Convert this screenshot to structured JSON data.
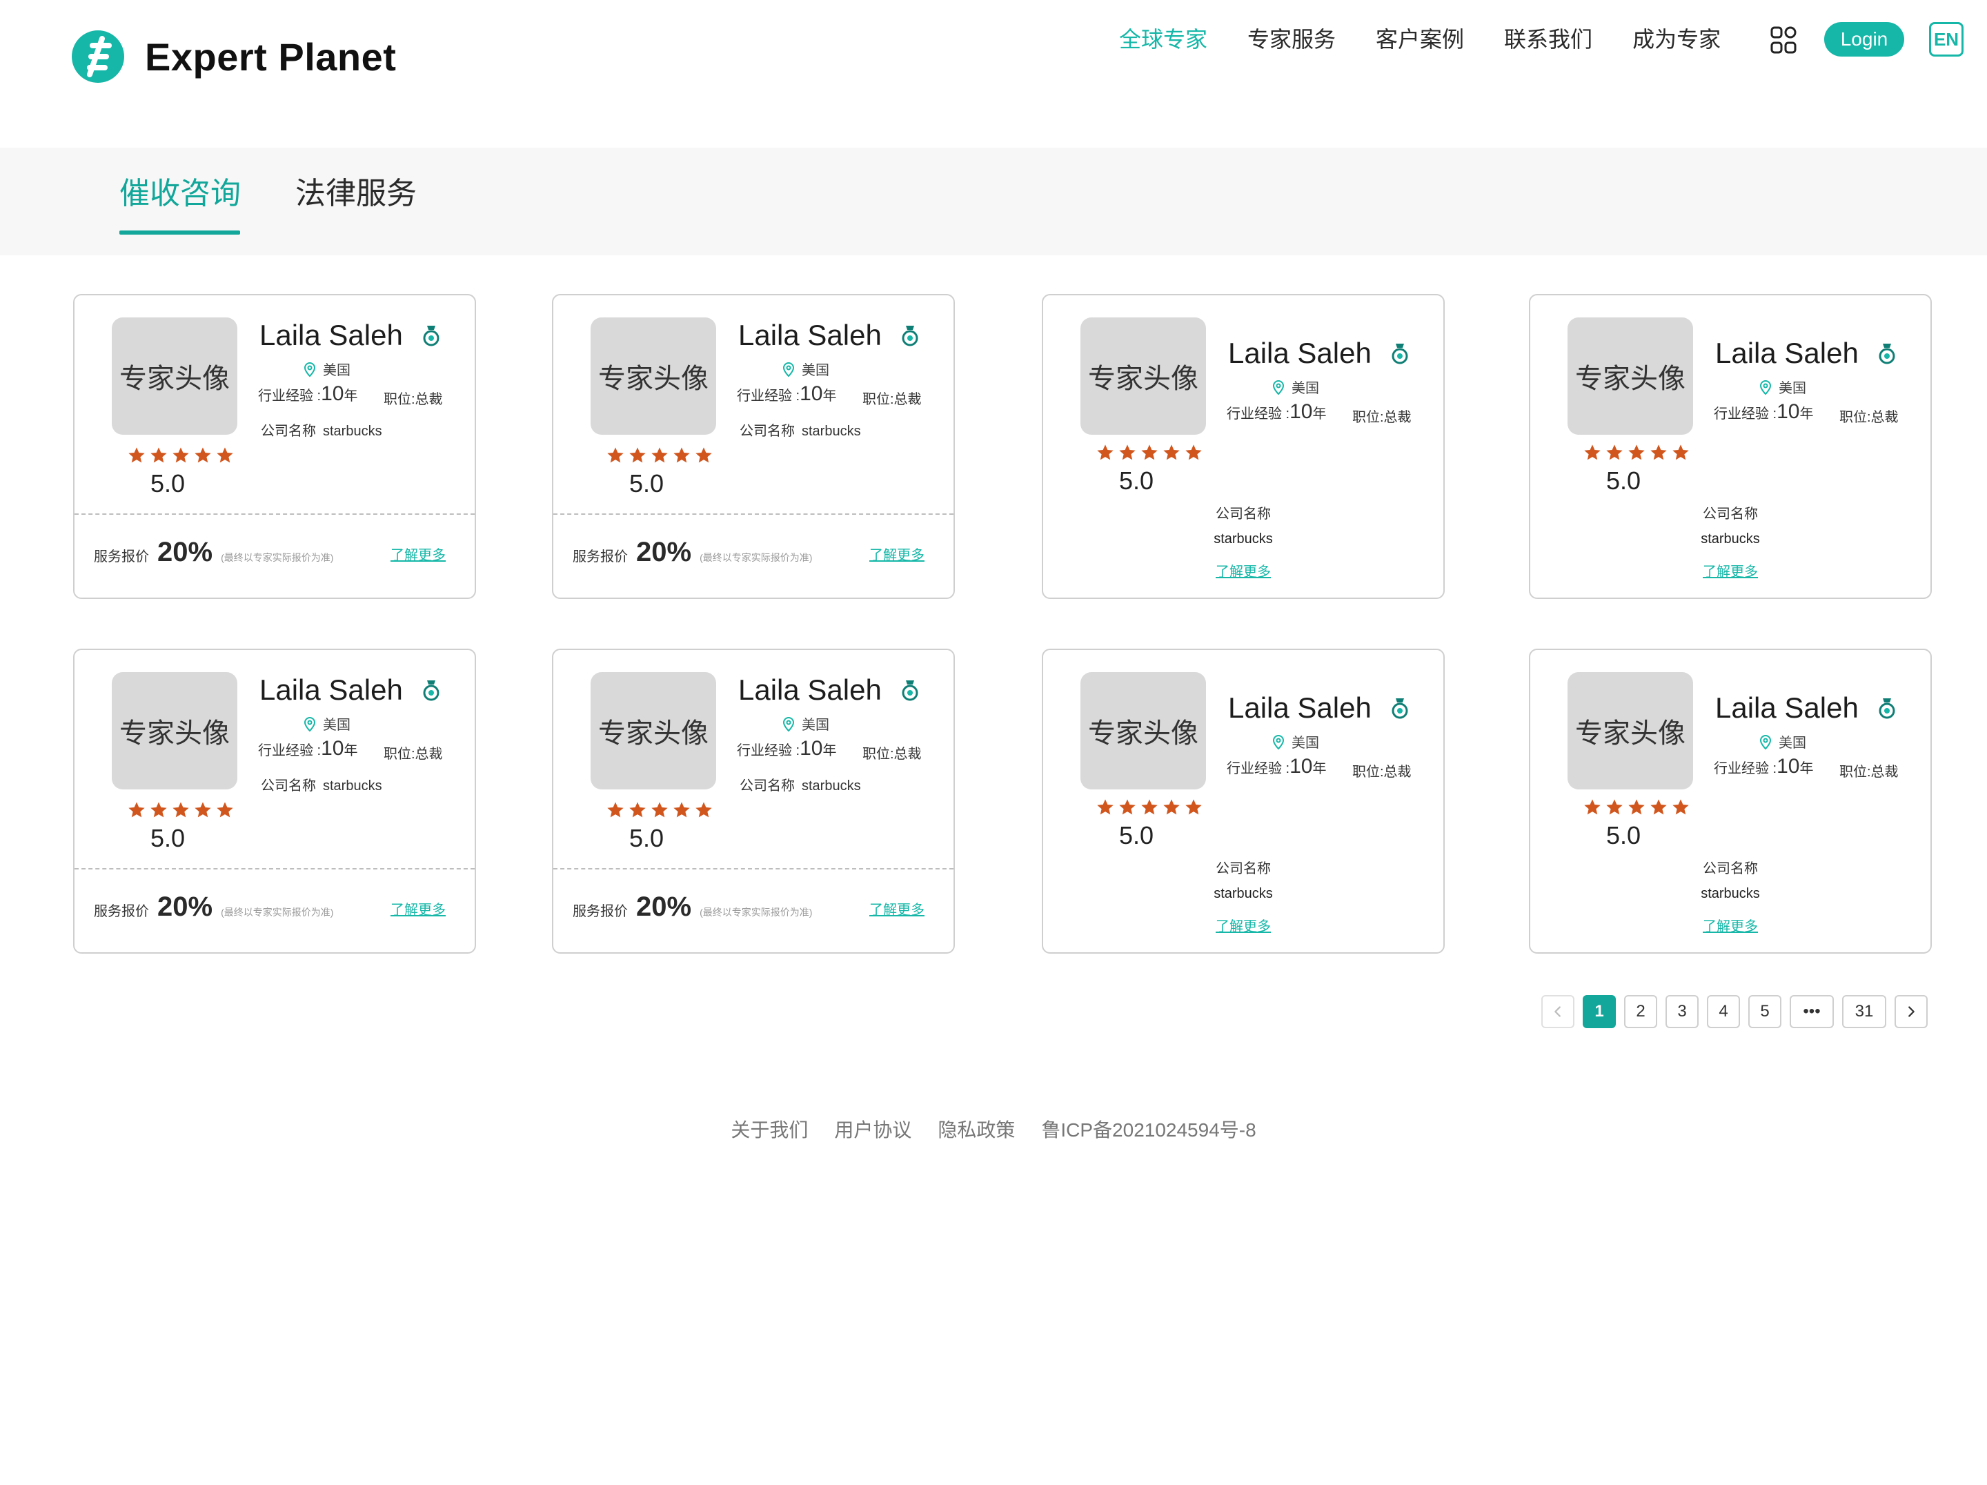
{
  "brand": {
    "name": "Expert Planet"
  },
  "nav": {
    "items": [
      "全球专家",
      "专家服务",
      "客户案例",
      "联系我们",
      "成为专家"
    ],
    "active_index": 0,
    "login": "Login",
    "lang": "EN"
  },
  "tabs": {
    "items": [
      "催收咨询",
      "法律服务"
    ],
    "active_index": 0
  },
  "cards": [
    {
      "avatar": "专家头像",
      "name": "Laila Saleh",
      "rating": "5.0",
      "location": "美国",
      "exp_label": "行业经验 :",
      "exp_num": "10",
      "exp_unit": "年",
      "position": "职位:总裁",
      "company_label": "公司名称",
      "company": "starbucks",
      "price_label": "服务报价",
      "price": "20%",
      "price_note": "(最终以专家实际报价为准)",
      "more": "了解更多"
    },
    {
      "avatar": "专家头像",
      "name": "Laila Saleh",
      "rating": "5.0",
      "location": "美国",
      "exp_label": "行业经验 :",
      "exp_num": "10",
      "exp_unit": "年",
      "position": "职位:总裁",
      "company_label": "公司名称",
      "company": "starbucks",
      "price_label": "服务报价",
      "price": "20%",
      "price_note": "(最终以专家实际报价为准)",
      "more": "了解更多"
    },
    {
      "avatar": "专家头像",
      "name": "Laila Saleh",
      "rating": "5.0",
      "location": "美国",
      "exp_label": "行业经验 :",
      "exp_num": "10",
      "exp_unit": "年",
      "position": "职位:总裁",
      "company_label": "公司名称",
      "company": "starbucks",
      "more": "了解更多"
    },
    {
      "avatar": "专家头像",
      "name": "Laila Saleh",
      "rating": "5.0",
      "location": "美国",
      "exp_label": "行业经验 :",
      "exp_num": "10",
      "exp_unit": "年",
      "position": "职位:总裁",
      "company_label": "公司名称",
      "company": "starbucks",
      "more": "了解更多"
    },
    {
      "avatar": "专家头像",
      "name": "Laila Saleh",
      "rating": "5.0",
      "location": "美国",
      "exp_label": "行业经验 :",
      "exp_num": "10",
      "exp_unit": "年",
      "position": "职位:总裁",
      "company_label": "公司名称",
      "company": "starbucks",
      "price_label": "服务报价",
      "price": "20%",
      "price_note": "(最终以专家实际报价为准)",
      "more": "了解更多"
    },
    {
      "avatar": "专家头像",
      "name": "Laila Saleh",
      "rating": "5.0",
      "location": "美国",
      "exp_label": "行业经验 :",
      "exp_num": "10",
      "exp_unit": "年",
      "position": "职位:总裁",
      "company_label": "公司名称",
      "company": "starbucks",
      "price_label": "服务报价",
      "price": "20%",
      "price_note": "(最终以专家实际报价为准)",
      "more": "了解更多"
    },
    {
      "avatar": "专家头像",
      "name": "Laila Saleh",
      "rating": "5.0",
      "location": "美国",
      "exp_label": "行业经验 :",
      "exp_num": "10",
      "exp_unit": "年",
      "position": "职位:总裁",
      "company_label": "公司名称",
      "company": "starbucks",
      "more": "了解更多"
    },
    {
      "avatar": "专家头像",
      "name": "Laila Saleh",
      "rating": "5.0",
      "location": "美国",
      "exp_label": "行业经验 :",
      "exp_num": "10",
      "exp_unit": "年",
      "position": "职位:总裁",
      "company_label": "公司名称",
      "company": "starbucks",
      "more": "了解更多"
    }
  ],
  "pagination": {
    "prev_icon": "chevron-left-icon",
    "pages": [
      "1",
      "2",
      "3",
      "4",
      "5",
      "•••",
      "31"
    ],
    "active": "1",
    "next_icon": "chevron-right-icon"
  },
  "footer": {
    "links": [
      "关于我们",
      "用户协议",
      "隐私政策",
      "鲁ICP备2021024594号-8"
    ]
  },
  "colors": {
    "accent": "#16B7A8",
    "star": "#D1561D"
  },
  "icons": {
    "logo": "expert-planet-logo",
    "apps": "apps-grid-icon",
    "badge": "medal-icon",
    "location": "location-pin-icon",
    "star": "star-icon"
  }
}
